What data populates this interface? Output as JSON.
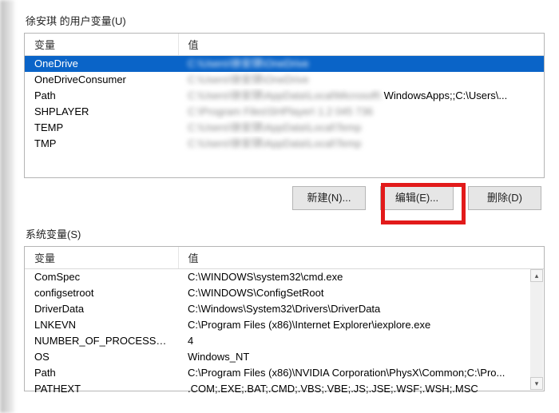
{
  "user": {
    "section_label": "徐安琪 的用户变量(U)",
    "columns": {
      "var": "变量",
      "val": "值"
    },
    "rows": [
      {
        "var": "OneDrive",
        "val": "C:\\Users\\徐安琪\\OneDrive",
        "selected": true,
        "blur": true
      },
      {
        "var": "OneDriveConsumer",
        "val": "C:\\Users\\徐安琪\\OneDrive",
        "blur": true
      },
      {
        "var": "Path",
        "val": "C:\\Users\\徐安琪\\AppData\\Local\\Microsoft\\ WindowsApps;;C:\\Users\\...",
        "blur": "partial"
      },
      {
        "var": "SHPLAYER",
        "val": "C:\\Program Files\\SHPlayer\\   1.2   045   736",
        "blur": true
      },
      {
        "var": "TEMP",
        "val": "C:\\Users\\徐安琪\\AppData\\Local\\Temp",
        "blur": true
      },
      {
        "var": "TMP",
        "val": "C:\\Users\\徐安琪\\AppData\\Local\\Temp",
        "blur": true
      }
    ]
  },
  "buttons": {
    "new": "新建(N)...",
    "edit": "编辑(E)...",
    "delete": "删除(D)"
  },
  "system": {
    "section_label": "系统变量(S)",
    "columns": {
      "var": "变量",
      "val": "值"
    },
    "rows": [
      {
        "var": "ComSpec",
        "val": "C:\\WINDOWS\\system32\\cmd.exe"
      },
      {
        "var": "configsetroot",
        "val": "C:\\WINDOWS\\ConfigSetRoot"
      },
      {
        "var": "DriverData",
        "val": "C:\\Windows\\System32\\Drivers\\DriverData"
      },
      {
        "var": "LNKEVN",
        "val": "C:\\Program Files (x86)\\Internet Explorer\\iexplore.exe"
      },
      {
        "var": "NUMBER_OF_PROCESSORS",
        "val": "4"
      },
      {
        "var": "OS",
        "val": "Windows_NT"
      },
      {
        "var": "Path",
        "val": "C:\\Program Files (x86)\\NVIDIA Corporation\\PhysX\\Common;C:\\Pro..."
      },
      {
        "var": "PATHEXT",
        "val": ".COM;.EXE;.BAT;.CMD;.VBS;.VBE;.JS;.JSE;.WSF;.WSH;.MSC"
      }
    ]
  }
}
